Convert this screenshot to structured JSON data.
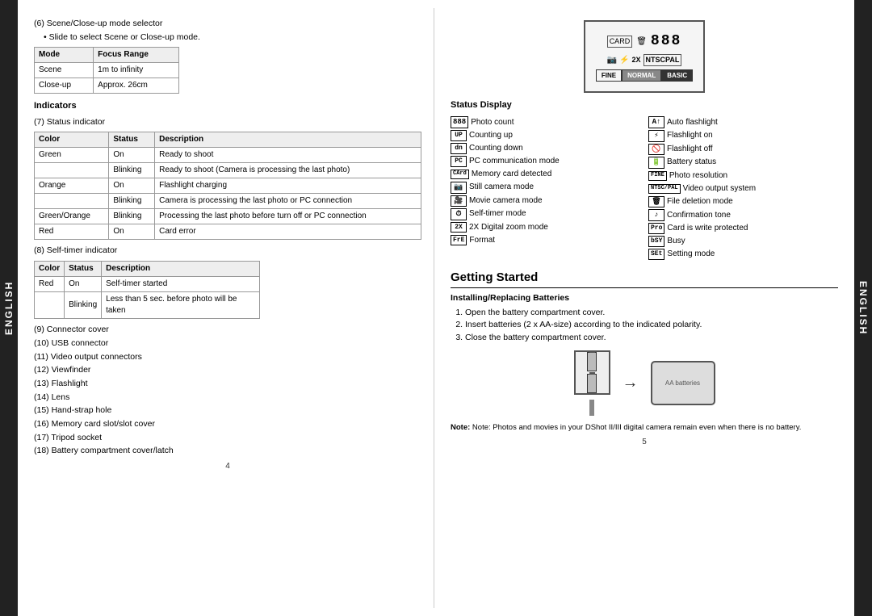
{
  "left_tab": "ENGLISH",
  "right_tab": "ENGLISH",
  "left_page": {
    "section6": {
      "title": "(6) Scene/Close-up mode selector",
      "sub": "• Slide to select Scene or Close-up mode.",
      "focus_table": {
        "headers": [
          "Mode",
          "Focus Range"
        ],
        "rows": [
          [
            "Scene",
            "1m to infinity"
          ],
          [
            "Close-up",
            "Approx. 26cm"
          ]
        ]
      }
    },
    "indicators": {
      "title": "Indicators",
      "section7": {
        "label": "(7) Status indicator",
        "table": {
          "headers": [
            "Color",
            "Status",
            "Description"
          ],
          "rows": [
            [
              "Green",
              "On",
              "Ready to shoot"
            ],
            [
              "",
              "Blinking",
              "Ready to shoot (Camera is processing the last photo)"
            ],
            [
              "Orange",
              "On",
              "Flashlight charging"
            ],
            [
              "",
              "Blinking",
              "Camera is processing the last photo or PC connection"
            ],
            [
              "Green/Orange",
              "Blinking",
              "Processing the last photo before turn off or PC connection"
            ],
            [
              "Red",
              "On",
              "Card error"
            ]
          ]
        }
      },
      "section8": {
        "label": "(8) Self-timer indicator",
        "table": {
          "headers": [
            "Color",
            "Status",
            "Description"
          ],
          "rows": [
            [
              "Red",
              "On",
              "Self-timer started"
            ],
            [
              "",
              "Blinking",
              "Less than 5 sec. before photo will be taken"
            ]
          ]
        }
      }
    },
    "items": [
      "(9) Connector cover",
      "(10) USB connector",
      "(11) Video output connectors",
      "(12) Viewfinder",
      "(13) Flashlight",
      "(14) Lens",
      "(15) Hand-strap hole",
      "(16) Memory card slot/slot cover",
      "(17) Tripod socket",
      "(18) Battery compartment cover/latch"
    ],
    "page_number": "4"
  },
  "right_page": {
    "camera_display": {
      "icons_top": [
        "CARD",
        "🗑",
        "888"
      ],
      "icons_mid": [
        "📷",
        "⚡",
        "2X",
        "NTSCPAL"
      ],
      "modes": [
        "FINE",
        "NORMAL",
        "BASIC"
      ]
    },
    "status_display": {
      "title": "Status Display",
      "left_items": [
        {
          "symbol": "888",
          "text": "Photo count"
        },
        {
          "symbol": "UP",
          "text": "Counting up"
        },
        {
          "symbol": "dn",
          "text": "Counting down"
        },
        {
          "symbol": "PC",
          "text": "PC communication mode"
        },
        {
          "symbol": "CArd",
          "text": "Memory card detected"
        },
        {
          "symbol": "📷",
          "text": "Still camera mode"
        },
        {
          "symbol": "🎥",
          "text": "Movie camera mode"
        },
        {
          "symbol": "⏱",
          "text": "Self-timer mode"
        },
        {
          "symbol": "2X",
          "text": "2X Digital zoom mode"
        },
        {
          "symbol": "FrE",
          "text": "Format"
        }
      ],
      "right_items": [
        {
          "symbol": "A↑",
          "text": "Auto flashlight"
        },
        {
          "symbol": "⚡",
          "text": "Flashlight on"
        },
        {
          "symbol": "⊘",
          "text": "Flashlight off"
        },
        {
          "symbol": "🔋",
          "text": "Battery status"
        },
        {
          "symbol": "FINE",
          "text": "Photo resolution"
        },
        {
          "symbol": "NTSC/PAL",
          "text": "Video output system"
        },
        {
          "symbol": "🗑",
          "text": "File deletion mode"
        },
        {
          "symbol": "♪",
          "text": "Confirmation tone"
        },
        {
          "symbol": "Pro",
          "text": "Card is write protected"
        },
        {
          "symbol": "bSY",
          "text": "Busy"
        },
        {
          "symbol": "SEt",
          "text": "Setting mode"
        }
      ]
    },
    "getting_started": {
      "title": "Getting Started",
      "installing": {
        "title": "Installing/Replacing Batteries",
        "steps": [
          "Open the battery compartment cover.",
          "Insert batteries (2 x AA-size) according to the indicated polarity.",
          "Close the battery compartment cover."
        ]
      },
      "note": "Note: Photos and movies in your DShot II/III digital camera remain even when there is no battery."
    },
    "page_number": "5"
  }
}
